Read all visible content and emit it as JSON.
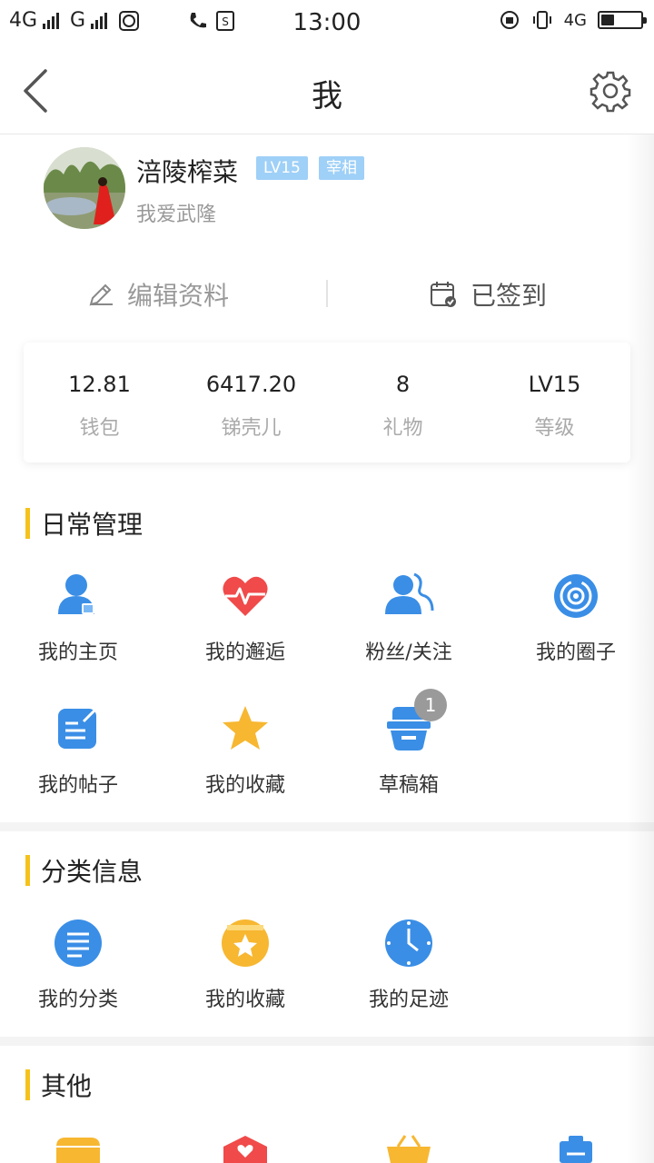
{
  "status_bar": {
    "network1": "4G",
    "network2": "G",
    "time": "13:00",
    "network3": "4G"
  },
  "header": {
    "title": "我"
  },
  "profile": {
    "username": "涪陵榨菜",
    "level_badge": "LV15",
    "title_badge": "宰相",
    "signature": "我爱武隆"
  },
  "actions": {
    "edit_label": "编辑资料",
    "signin_label": "已签到"
  },
  "stats": [
    {
      "value": "12.81",
      "label": "钱包"
    },
    {
      "value": "6417.20",
      "label": "锑壳儿"
    },
    {
      "value": "8",
      "label": "礼物"
    },
    {
      "value": "LV15",
      "label": "等级"
    }
  ],
  "daily": {
    "title": "日常管理",
    "items": [
      {
        "label": "我的主页",
        "icon": "user-icon"
      },
      {
        "label": "我的邂逅",
        "icon": "heartbeat-icon"
      },
      {
        "label": "粉丝/关注",
        "icon": "followers-icon"
      },
      {
        "label": "我的圈子",
        "icon": "circle-icon"
      },
      {
        "label": "我的帖子",
        "icon": "post-icon"
      },
      {
        "label": "我的收藏",
        "icon": "star-icon"
      },
      {
        "label": "草稿箱",
        "icon": "drafts-icon",
        "badge": "1"
      }
    ]
  },
  "category": {
    "title": "分类信息",
    "items": [
      {
        "label": "我的分类",
        "icon": "list-icon"
      },
      {
        "label": "我的收藏",
        "icon": "favorite-star-icon"
      },
      {
        "label": "我的足迹",
        "icon": "clock-icon"
      }
    ]
  },
  "other": {
    "title": "其他"
  },
  "colors": {
    "accent_bar": "#f5c21b",
    "blue_icon": "#3a8ee6",
    "red_icon": "#f04a4a",
    "yellow_icon": "#f7b731",
    "badge_blue": "#9fd0f7"
  }
}
